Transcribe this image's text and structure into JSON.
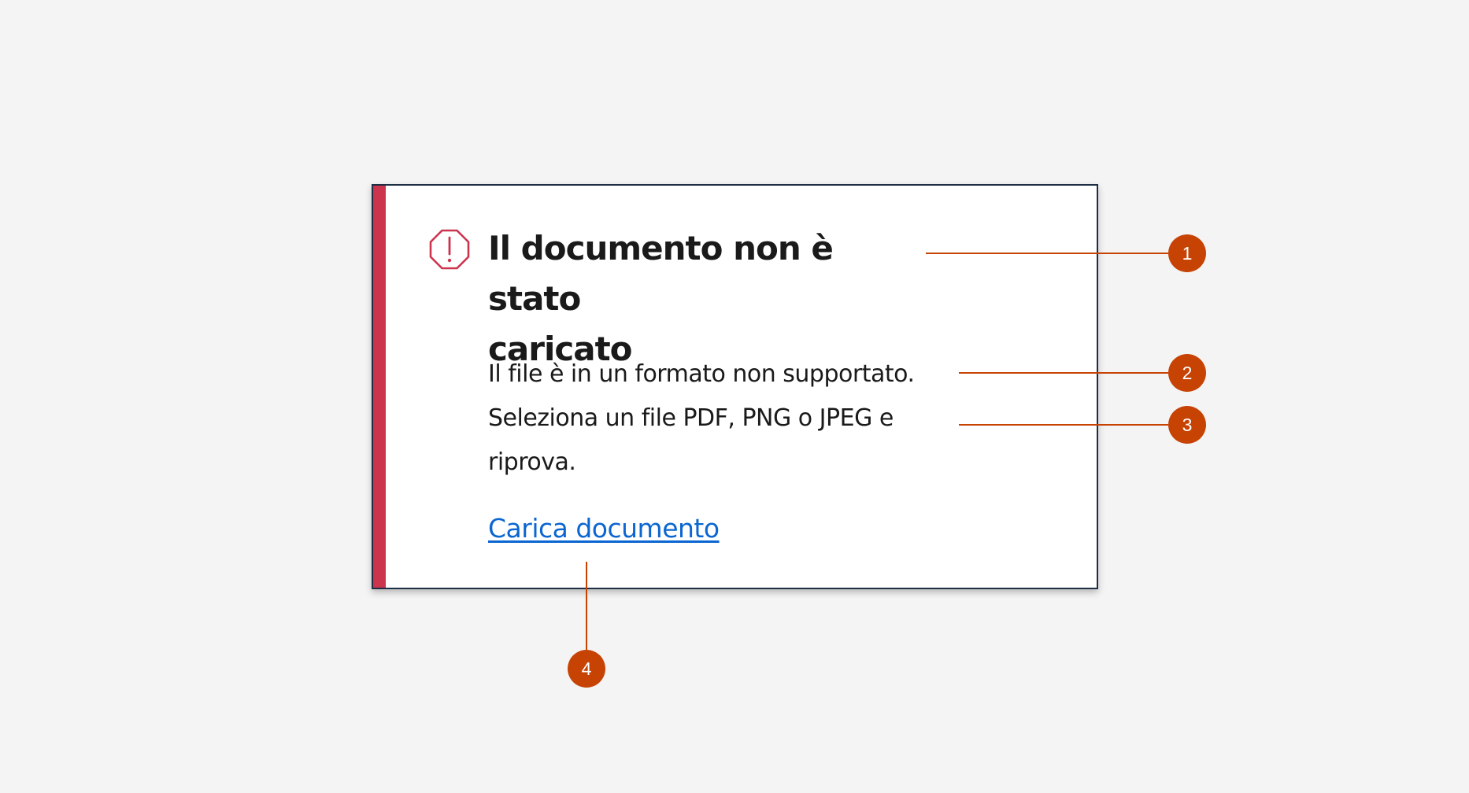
{
  "alert": {
    "title_line1": "Il documento non è stato",
    "title_line2": "caricato",
    "body_line1": "Il file è in un formato non supportato.",
    "body_line2": "Seleziona un file PDF, PNG o JPEG e",
    "body_line3": "riprova.",
    "action_label": "Carica documento",
    "icon": "alert-octagon-icon"
  },
  "callouts": [
    {
      "number": "1"
    },
    {
      "number": "2"
    },
    {
      "number": "3"
    },
    {
      "number": "4"
    }
  ],
  "colors": {
    "background": "#f4f4f4",
    "accent": "#cc334d",
    "border": "#1e2e45",
    "link": "#0b66d1",
    "callout": "#c64304",
    "text": "#1a1a1a"
  }
}
